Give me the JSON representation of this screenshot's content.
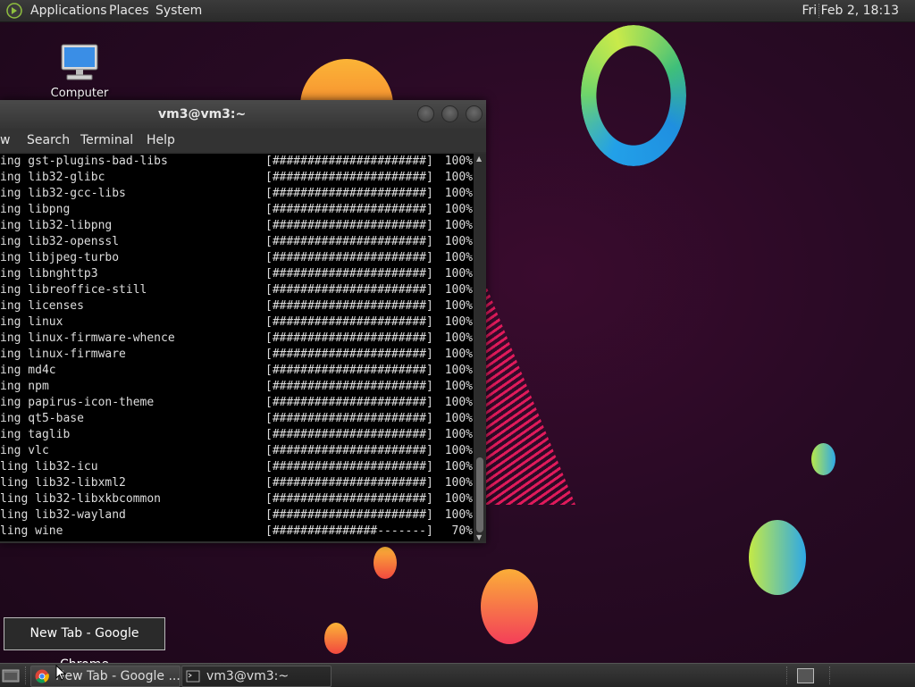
{
  "top_panel": {
    "apps_icon": "mate-logo-icon",
    "menus": [
      "Applications",
      "Places",
      "System"
    ],
    "clock": "Fri Feb  2, 18:13"
  },
  "desktop": {
    "icons": [
      {
        "label": "Computer",
        "icon": "computer-monitor-icon"
      }
    ]
  },
  "terminal": {
    "title": "vm3@vm3:~",
    "menu": [
      "w",
      "Search",
      "Terminal",
      "Help"
    ],
    "lines": [
      {
        "name": "ing gst-plugins-bad-libs",
        "bar": "[######################]",
        "pct": "100%"
      },
      {
        "name": "ing lib32-glibc",
        "bar": "[######################]",
        "pct": "100%"
      },
      {
        "name": "ing lib32-gcc-libs",
        "bar": "[######################]",
        "pct": "100%"
      },
      {
        "name": "ing libpng",
        "bar": "[######################]",
        "pct": "100%"
      },
      {
        "name": "ing lib32-libpng",
        "bar": "[######################]",
        "pct": "100%"
      },
      {
        "name": "ing lib32-openssl",
        "bar": "[######################]",
        "pct": "100%"
      },
      {
        "name": "ing libjpeg-turbo",
        "bar": "[######################]",
        "pct": "100%"
      },
      {
        "name": "ing libnghttp3",
        "bar": "[######################]",
        "pct": "100%"
      },
      {
        "name": "ing libreoffice-still",
        "bar": "[######################]",
        "pct": "100%"
      },
      {
        "name": "ing licenses",
        "bar": "[######################]",
        "pct": "100%"
      },
      {
        "name": "ing linux",
        "bar": "[######################]",
        "pct": "100%"
      },
      {
        "name": "ing linux-firmware-whence",
        "bar": "[######################]",
        "pct": "100%"
      },
      {
        "name": "ing linux-firmware",
        "bar": "[######################]",
        "pct": "100%"
      },
      {
        "name": "ing md4c",
        "bar": "[######################]",
        "pct": "100%"
      },
      {
        "name": "ing npm",
        "bar": "[######################]",
        "pct": "100%"
      },
      {
        "name": "ing papirus-icon-theme",
        "bar": "[######################]",
        "pct": "100%"
      },
      {
        "name": "ing qt5-base",
        "bar": "[######################]",
        "pct": "100%"
      },
      {
        "name": "ing taglib",
        "bar": "[######################]",
        "pct": "100%"
      },
      {
        "name": "ing vlc",
        "bar": "[######################]",
        "pct": "100%"
      },
      {
        "name": "ling lib32-icu",
        "bar": "[######################]",
        "pct": "100%"
      },
      {
        "name": "ling lib32-libxml2",
        "bar": "[######################]",
        "pct": "100%"
      },
      {
        "name": "ling lib32-libxkbcommon",
        "bar": "[######################]",
        "pct": "100%"
      },
      {
        "name": "ling lib32-wayland",
        "bar": "[######################]",
        "pct": "100%"
      },
      {
        "name": "ling wine",
        "bar": "[###############-------]",
        "pct": "70%"
      }
    ]
  },
  "tooltip": "New Tab - Google Chrome",
  "taskbar": {
    "show_desktop_icon": "show-desktop-icon",
    "tasks": [
      {
        "label": "New Tab - Google ...",
        "icon": "chrome-icon"
      },
      {
        "label": "vm3@vm3:~",
        "icon": "terminal-icon"
      }
    ],
    "workspace_icon": "workspace-switcher-icon"
  },
  "colors": {
    "desktop_bg": "#280a24",
    "panel": "#2f2f2f",
    "terminal_bg": "#000000",
    "terminal_fg": "#dddddd"
  }
}
